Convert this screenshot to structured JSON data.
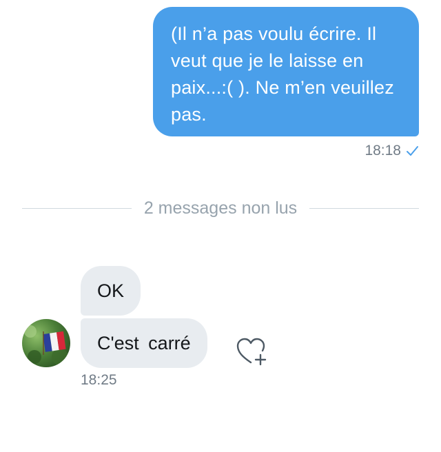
{
  "conversation": {
    "outgoing": {
      "text": "(Il n’a pas voulu écrire. Il veut que je le laisse en paix...:( ). Ne m’en veuillez pas.",
      "time": "18:18",
      "status_icon": "checkmark-icon",
      "bubble_color": "#4a9fea"
    },
    "unread_divider": {
      "label": "2 messages non lus"
    },
    "incoming": {
      "messages": [
        {
          "text": "OK"
        },
        {
          "text": "C'est carré"
        }
      ],
      "time": "18:25",
      "avatar_icon": "avatar-french-flag",
      "reaction_icon": "heart-plus-icon",
      "bubble_color": "#e8ecf0"
    }
  }
}
